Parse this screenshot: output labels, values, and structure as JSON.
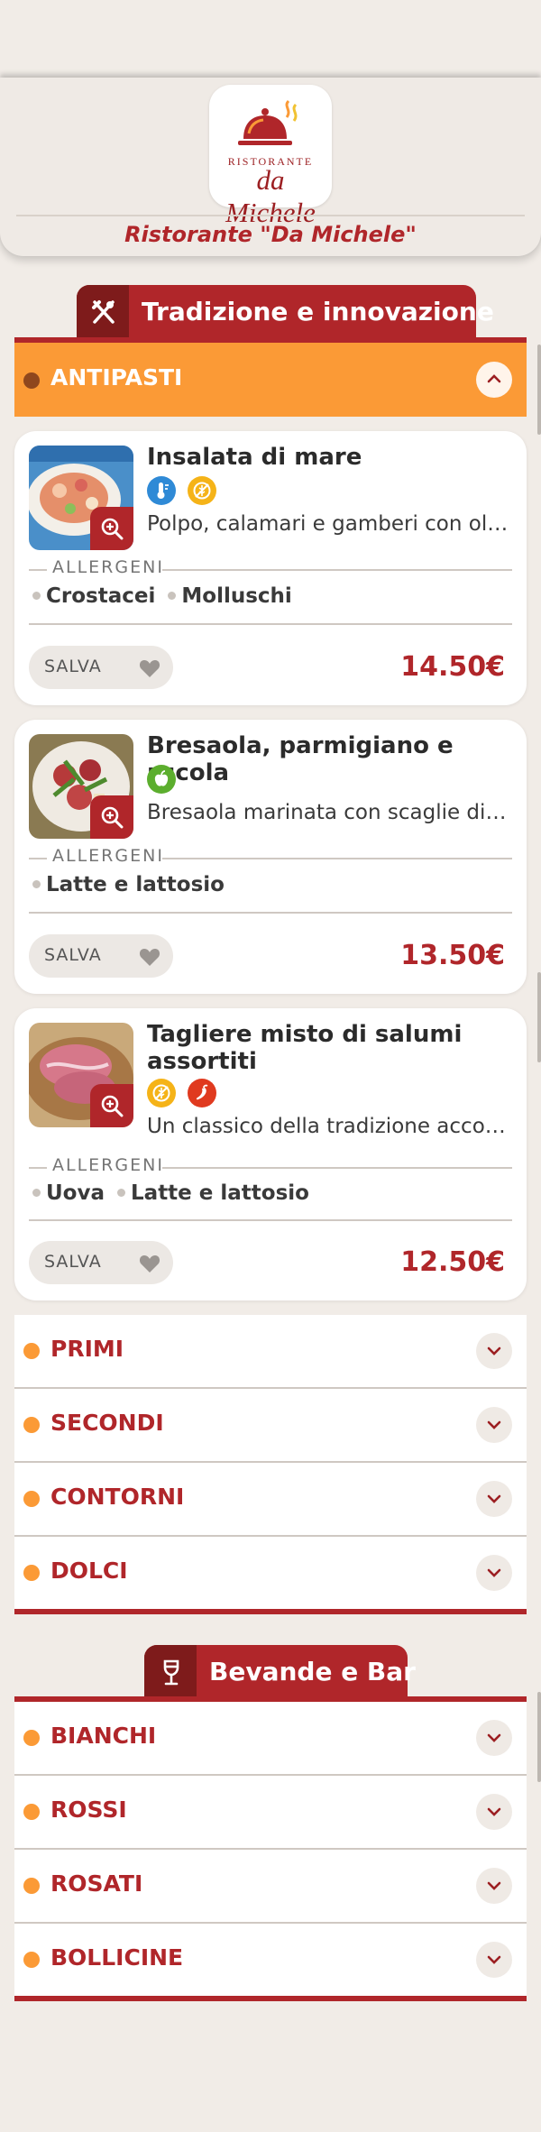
{
  "header": {
    "logo_small": "RISTORANTE",
    "logo_big": "da Michele",
    "restaurant_name": "Ristorante \"Da Michele\""
  },
  "food_section": {
    "title": "Tradizione e innovazione",
    "icon": "fork-knife-icon",
    "open_category": {
      "label": "ANTIPASTI",
      "toggle_icon": "chevron-up-icon",
      "dishes": [
        {
          "name": "Insalata di mare",
          "icons": [
            "cold-thermometer-icon",
            "no-gluten-icon"
          ],
          "description": "Polpo, calamari e gamberi con olio extravergine",
          "allergens_label": "ALLERGENI",
          "allergens": [
            "Crostacei",
            "Molluschi"
          ],
          "save_label": "SALVA",
          "price": "14.50€"
        },
        {
          "name": "Bresaola, parmigiano e rucola",
          "icons": [
            "vegetarian-apple-icon"
          ],
          "description": "Bresaola marinata con scaglie di parmigiano e rucola",
          "allergens_label": "ALLERGENI",
          "allergens": [
            "Latte e lattosio"
          ],
          "save_label": "SALVA",
          "price": "13.50€"
        },
        {
          "name": "Tagliere misto di salumi assortiti",
          "icons": [
            "no-gluten-icon",
            "spicy-chili-icon"
          ],
          "description": "Un classico della tradizione accompagnato da focaccia",
          "allergens_label": "ALLERGENI",
          "allergens": [
            "Uova",
            "Latte e lattosio"
          ],
          "save_label": "SALVA",
          "price": "12.50€"
        }
      ]
    },
    "categories": [
      "PRIMI",
      "SECONDI",
      "CONTORNI",
      "DOLCI"
    ]
  },
  "drinks_section": {
    "title": "Bevande e Bar",
    "icon": "wine-glass-icon",
    "categories": [
      "BIANCHI",
      "ROSSI",
      "ROSATI",
      "BOLLICINE"
    ]
  },
  "colors": {
    "brand_red": "#b0262a",
    "dark_red": "#7e1b1b",
    "accent_orange": "#fb9a36",
    "background": "#f1ece7"
  }
}
